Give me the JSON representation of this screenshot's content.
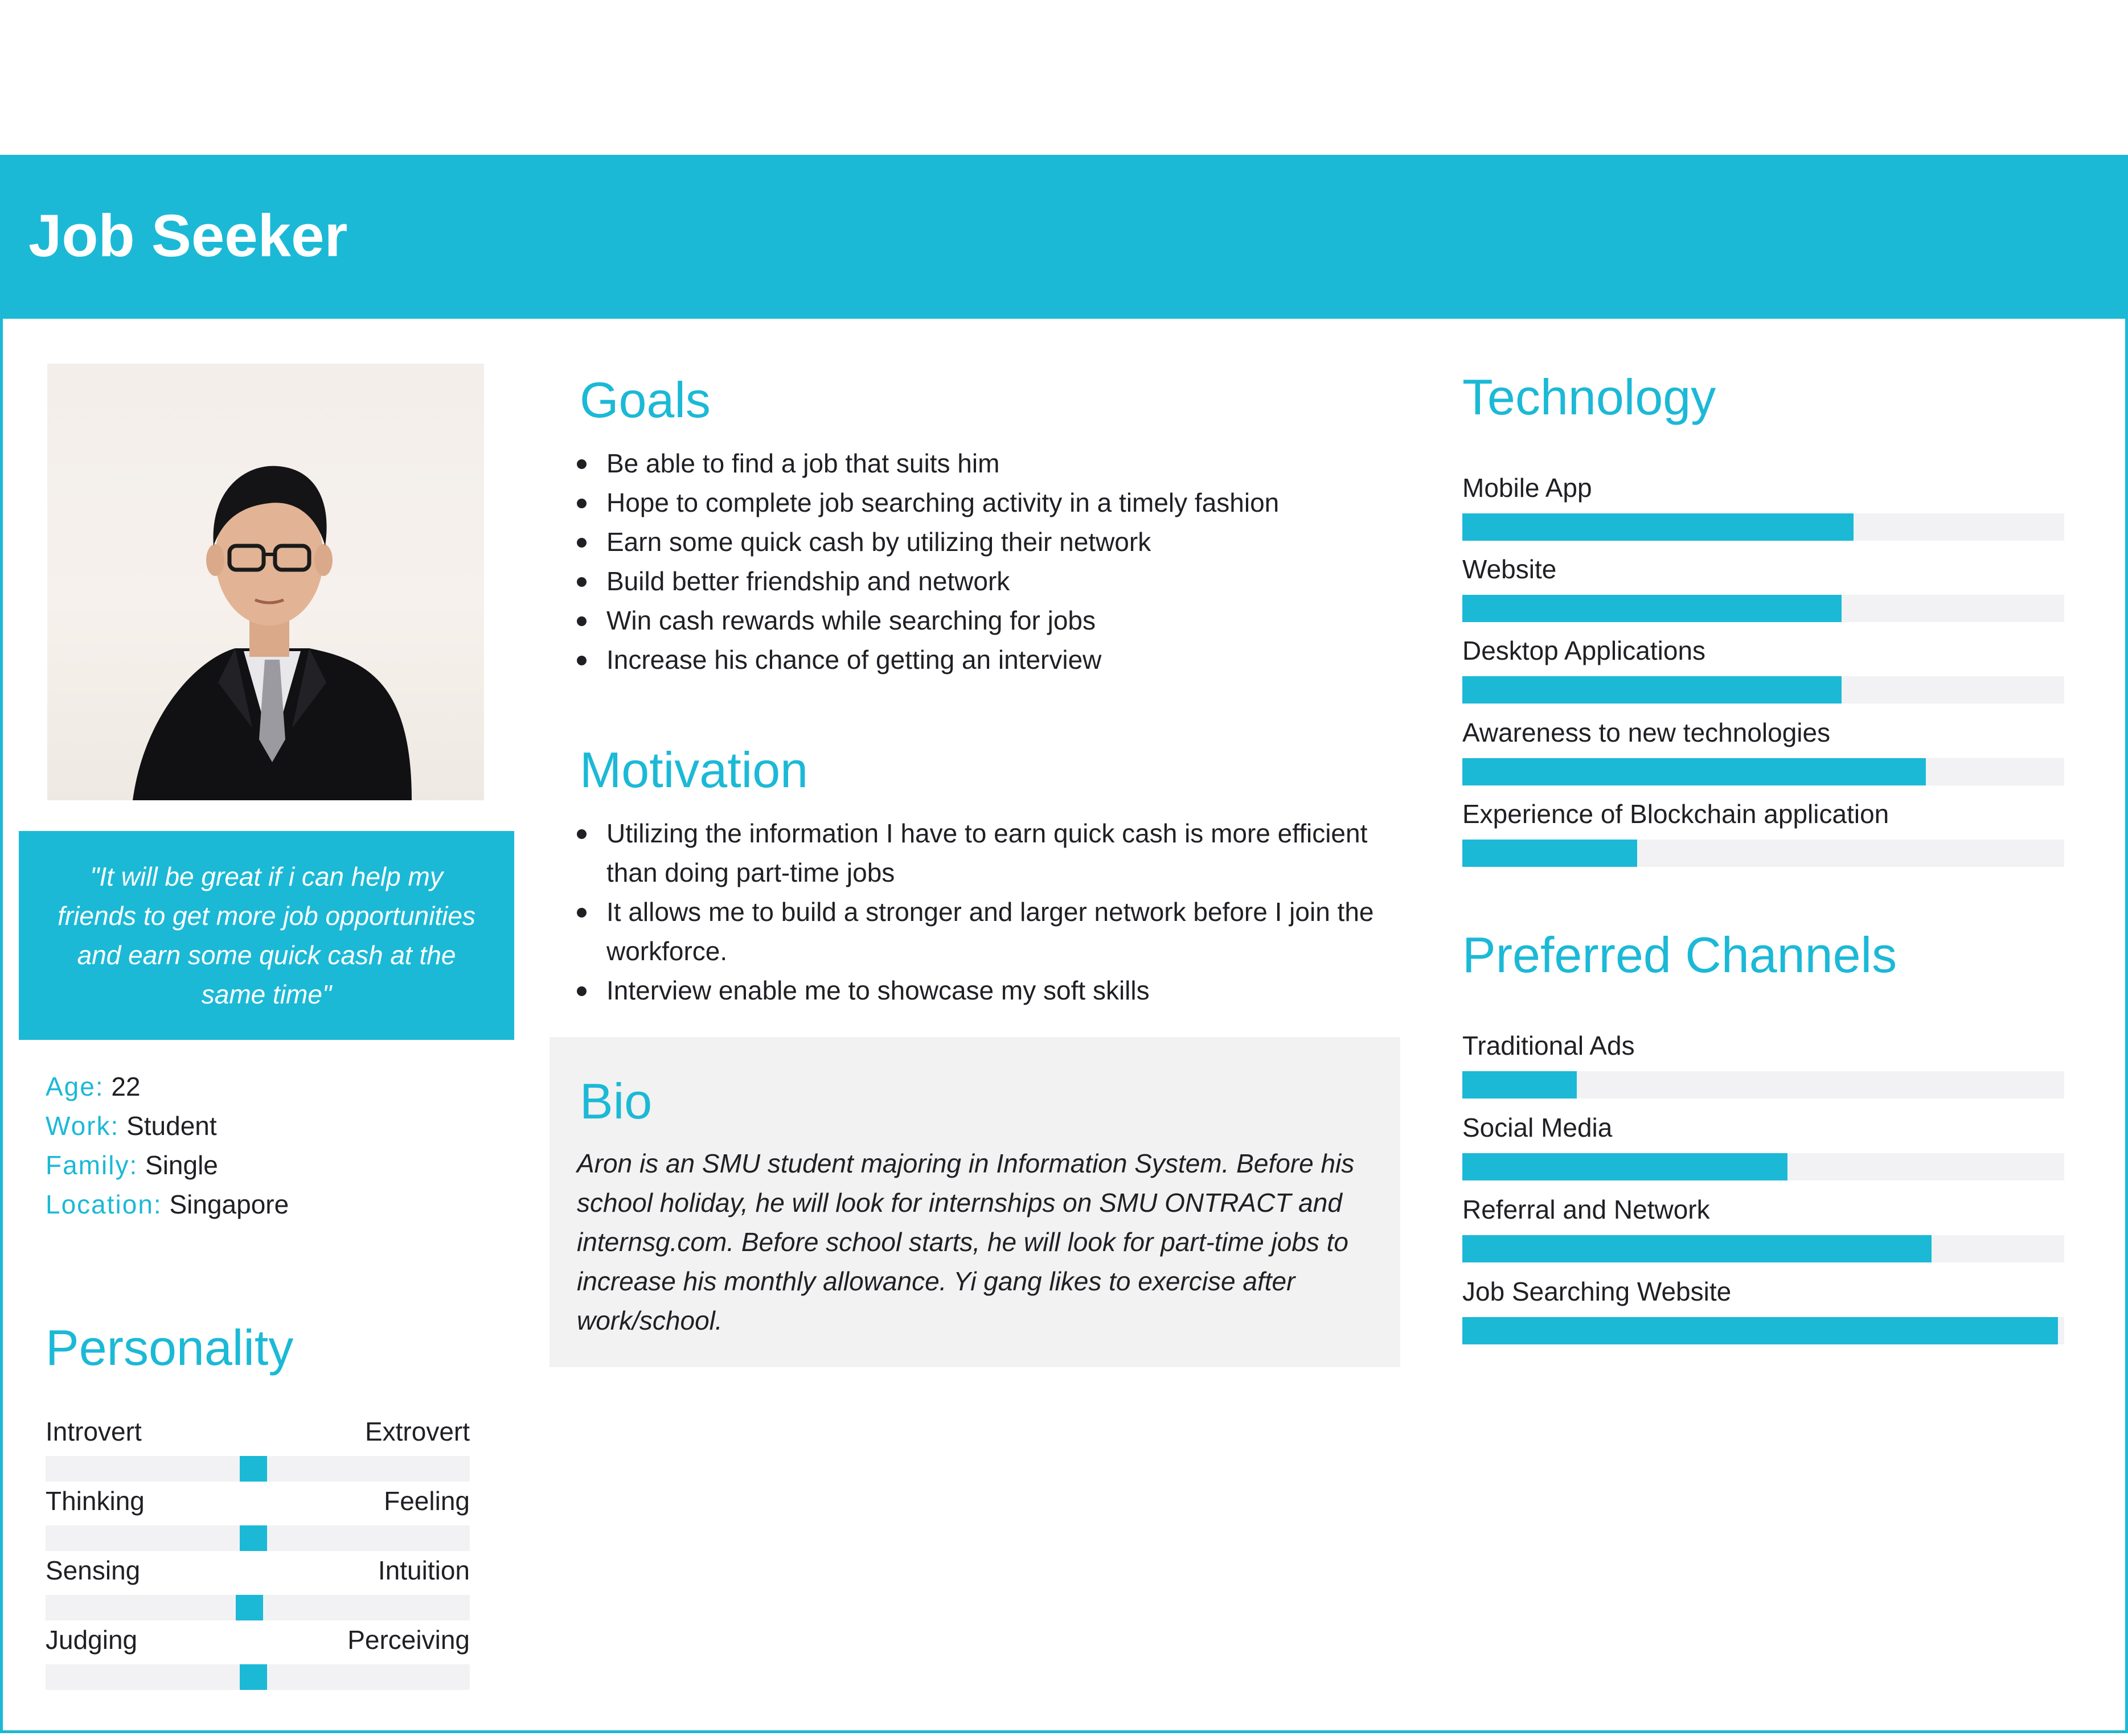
{
  "header": {
    "title": "Job Seeker"
  },
  "profile": {
    "quote": "\"It will be great if i can help my friends to get more job opportunities and earn some quick cash at the same time\"",
    "facts": [
      {
        "label": "Age:",
        "value": "22"
      },
      {
        "label": "Work:",
        "value": "Student"
      },
      {
        "label": "Family:",
        "value": "Single"
      },
      {
        "label": "Location:",
        "value": "Singapore"
      }
    ]
  },
  "personality": {
    "title": "Personality",
    "scales": [
      {
        "left": "Introvert",
        "right": "Extrovert",
        "position": 0.49
      },
      {
        "left": "Thinking",
        "right": "Feeling",
        "position": 0.49
      },
      {
        "left": "Sensing",
        "right": "Intuition",
        "position": 0.48
      },
      {
        "left": "Judging",
        "right": "Perceiving",
        "position": 0.49
      }
    ]
  },
  "goals": {
    "title": "Goals",
    "items": [
      "Be able to find a job that suits him",
      "Hope to complete job searching activity in a timely fashion",
      "Earn some quick cash by utilizing their network",
      "Build better friendship and network",
      "Win cash rewards while searching for jobs",
      "Increase his chance of getting an interview"
    ]
  },
  "motivation": {
    "title": "Motivation",
    "items": [
      "Utilizing the information I have to earn quick cash is more efficient than doing part-time jobs",
      "It allows me to build a stronger and larger network before I join the workforce.",
      "Interview enable me to showcase my soft skills"
    ]
  },
  "bio": {
    "title": "Bio",
    "text": "Aron is an SMU student majoring in Information System. Before his school holiday, he will look for internships on SMU ONTRACT and internsg.com. Before school starts, he will look for part-time jobs to increase his monthly allowance. Yi gang likes to exercise after work/school."
  },
  "technology": {
    "title": "Technology",
    "items": [
      {
        "label": "Mobile App",
        "level": 0.65
      },
      {
        "label": "Website",
        "level": 0.63
      },
      {
        "label": "Desktop Applications",
        "level": 0.63
      },
      {
        "label": "Awareness to new technologies",
        "level": 0.77
      },
      {
        "label": "Experience of Blockchain application",
        "level": 0.29
      }
    ]
  },
  "channels": {
    "title": "Preferred Channels",
    "items": [
      {
        "label": "Traditional Ads",
        "level": 0.19
      },
      {
        "label": "Social Media",
        "level": 0.54
      },
      {
        "label": "Referral and Network",
        "level": 0.78
      },
      {
        "label": "Job Searching Website",
        "level": 0.99
      }
    ]
  },
  "colors": {
    "accent": "#1bb9d6",
    "track": "#f2f2f4",
    "bio_bg": "#f2f2f2",
    "text": "#1f1f24"
  }
}
